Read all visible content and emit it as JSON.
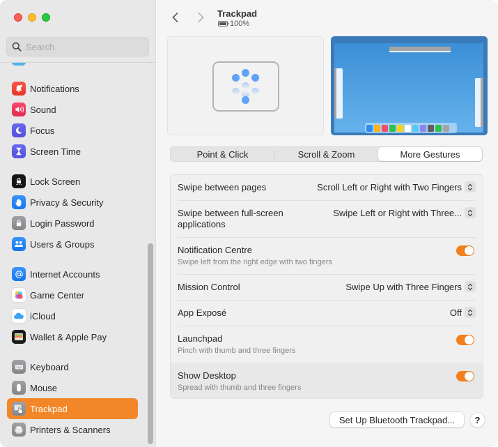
{
  "window": {
    "controls": [
      "close",
      "minimize",
      "maximize"
    ]
  },
  "sidebar": {
    "search": {
      "placeholder": "Search",
      "value": ""
    },
    "items": [
      {
        "label": "Notifications",
        "icon": "bell-icon",
        "color": "#f2463c"
      },
      {
        "label": "Sound",
        "icon": "speaker-icon",
        "color": "#f0365d"
      },
      {
        "label": "Focus",
        "icon": "moon-icon",
        "color": "#5e5ce6"
      },
      {
        "label": "Screen Time",
        "icon": "hourglass-icon",
        "color": "#5e5ce6"
      },
      {
        "label": "Lock Screen",
        "icon": "lock-screen-icon",
        "color": "#1c1c1e"
      },
      {
        "label": "Privacy & Security",
        "icon": "hand-icon",
        "color": "#1a82fb"
      },
      {
        "label": "Login Password",
        "icon": "lock-icon",
        "color": "#8e8e93"
      },
      {
        "label": "Users & Groups",
        "icon": "users-icon",
        "color": "#1a82fb"
      },
      {
        "label": "Internet Accounts",
        "icon": "at-icon",
        "color": "#1a82fb"
      },
      {
        "label": "Game Center",
        "icon": "game-center-icon",
        "color": "#ffffff"
      },
      {
        "label": "iCloud",
        "icon": "cloud-icon",
        "color": "#ffffff"
      },
      {
        "label": "Wallet & Apple Pay",
        "icon": "wallet-icon",
        "color": "#1c1c1e"
      },
      {
        "label": "Keyboard",
        "icon": "keyboard-icon",
        "color": "#8e8e93"
      },
      {
        "label": "Mouse",
        "icon": "mouse-icon",
        "color": "#8e8e93"
      },
      {
        "label": "Trackpad",
        "icon": "trackpad-icon",
        "color": "#8e8e93",
        "selected": true
      },
      {
        "label": "Printers & Scanners",
        "icon": "printer-icon",
        "color": "#8e8e93"
      }
    ]
  },
  "header": {
    "title": "Trackpad",
    "battery": "100%"
  },
  "tabs": [
    {
      "label": "Point & Click",
      "selected": false
    },
    {
      "label": "Scroll & Zoom",
      "selected": false
    },
    {
      "label": "More Gestures",
      "selected": true
    }
  ],
  "settings": [
    {
      "label": "Swipe between pages",
      "type": "popup",
      "value": "Scroll Left or Right with Two Fingers"
    },
    {
      "label": "Swipe between full-screen applications",
      "type": "popup",
      "value": "Swipe Left or Right with Three..."
    },
    {
      "label": "Notification Centre",
      "sublabel": "Swipe left from the right edge with two fingers",
      "type": "toggle",
      "value": true
    },
    {
      "label": "Mission Control",
      "type": "popup",
      "value": "Swipe Up with Three Fingers"
    },
    {
      "label": "App Exposé",
      "type": "popup",
      "value": "Off"
    },
    {
      "label": "Launchpad",
      "sublabel": "Pinch with thumb and three fingers",
      "type": "toggle",
      "value": true
    },
    {
      "label": "Show Desktop",
      "sublabel": "Spread with thumb and three fingers",
      "type": "toggle",
      "value": true
    }
  ],
  "footer": {
    "setup_button": "Set Up Bluetooth Trackpad...",
    "help_button": "?"
  },
  "colors": {
    "accent": "#f2872a",
    "toggle_on": "#f27f1b",
    "gesture_dot": "#5fa2f7"
  }
}
